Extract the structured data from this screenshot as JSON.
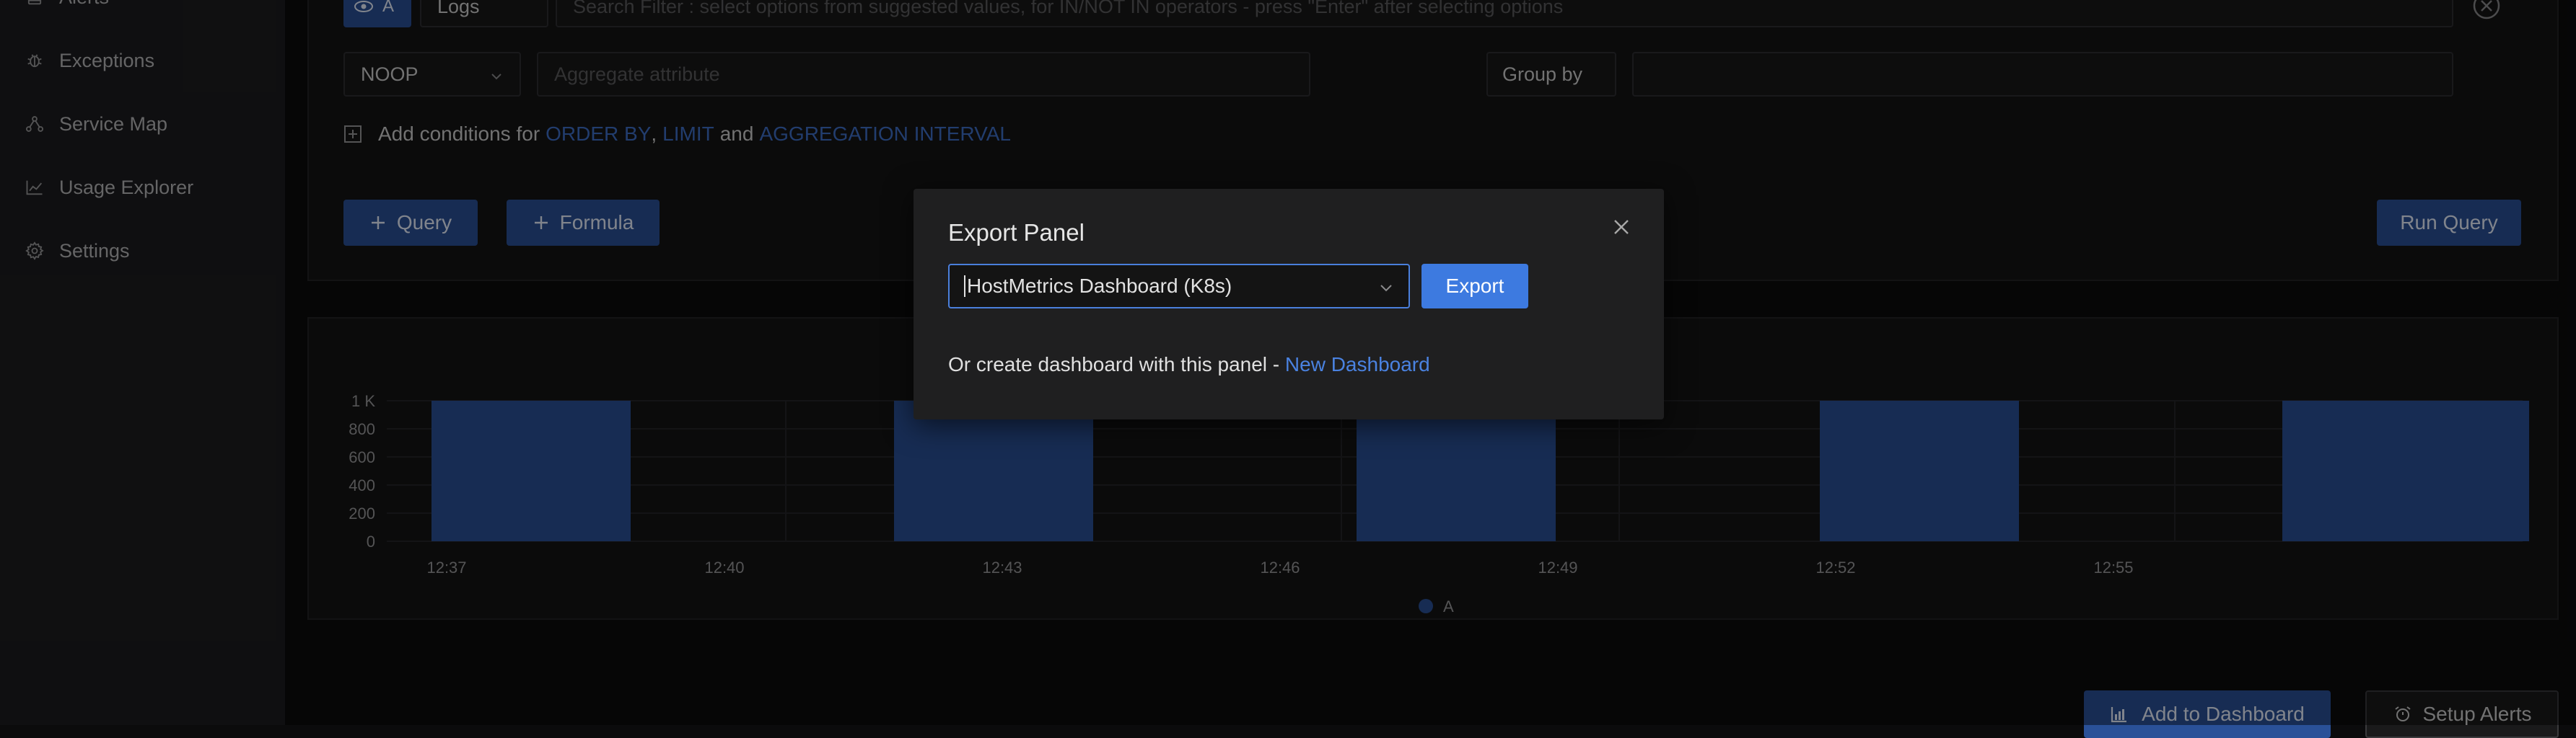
{
  "sidebar": {
    "items": [
      {
        "label": "Alerts",
        "icon": "alerts-icon"
      },
      {
        "label": "Exceptions",
        "icon": "bug-icon"
      },
      {
        "label": "Service Map",
        "icon": "service-map-icon"
      },
      {
        "label": "Usage Explorer",
        "icon": "line-chart-icon"
      },
      {
        "label": "Settings",
        "icon": "gear-icon"
      }
    ]
  },
  "query": {
    "query_letter": "A",
    "data_source": "Logs",
    "search_placeholder": "Search Filter : select options from suggested values, for IN/NOT IN operators - press \"Enter\" after selecting options",
    "aggregate_operator": "NOOP",
    "aggregate_placeholder": "Aggregate attribute",
    "group_by_label": "Group by",
    "conditions": {
      "prefix": "Add conditions for",
      "order_by": "ORDER BY",
      "comma": ",",
      "limit": "LIMIT",
      "and": "and",
      "interval": "AGGREGATION INTERVAL"
    },
    "add_query_label": "Query",
    "add_formula_label": "Formula",
    "run_query_label": "Run Query"
  },
  "chart_data": {
    "type": "bar",
    "y_ticks": [
      "0",
      "200",
      "400",
      "600",
      "800",
      "1 K"
    ],
    "x_ticks": [
      "12:37",
      "12:40",
      "12:43",
      "12:46",
      "12:49",
      "12:52",
      "12:55"
    ],
    "series": [
      {
        "name": "A",
        "color": "#2a5198"
      }
    ],
    "bar_values": [
      1000,
      1000,
      1000,
      1000,
      1000
    ],
    "ylim": [
      0,
      1000
    ],
    "legend": "bottom-center"
  },
  "footer": {
    "add_to_dashboard_label": "Add to Dashboard",
    "setup_alerts_label": "Setup Alerts"
  },
  "modal": {
    "title": "Export Panel",
    "selected_dashboard": "HostMetrics Dashboard (K8s)",
    "export_label": "Export",
    "create_text": "Or create dashboard with this panel -",
    "new_dashboard_link": "New Dashboard"
  },
  "colors": {
    "accent": "#2a5198",
    "export_button": "#3d7ae0",
    "link": "#3f6fc9",
    "background": "#0b0b0c"
  }
}
